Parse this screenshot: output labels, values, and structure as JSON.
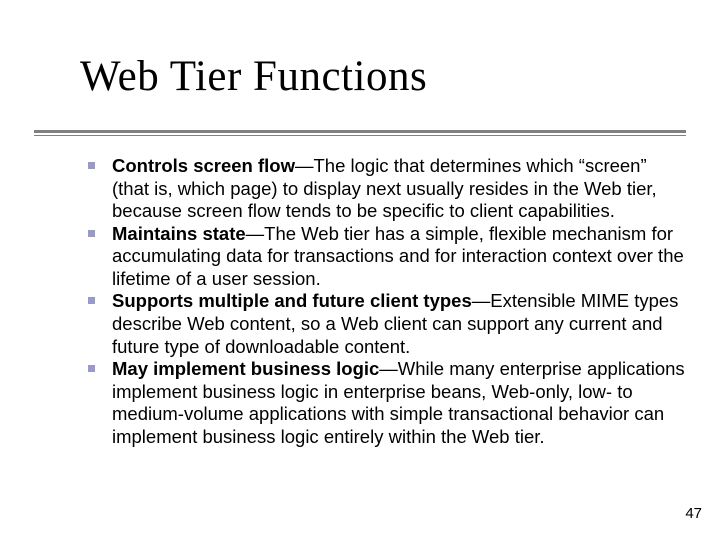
{
  "title": "Web Tier Functions",
  "items": [
    {
      "lead": "Controls screen flow",
      "body": "—The logic that determines which “screen” (that is, which page) to display next usually resides in the Web tier, because screen flow tends to be specific to client capabilities."
    },
    {
      "lead": "Maintains state",
      "body": "—The Web tier has a simple, flexible mechanism for accumulating data for transactions and for interaction context over the lifetime of a user session."
    },
    {
      "lead": "Supports multiple and future client types",
      "body": "—Extensible MIME types describe Web content, so a Web client can support any current and future type of downloadable content."
    },
    {
      "lead": "May implement business logic",
      "body": "—While many enterprise applications implement business logic in enterprise beans, Web-only, low- to medium-volume applications with simple transactional behavior can implement business logic entirely within the Web tier."
    }
  ],
  "page_number": "47"
}
